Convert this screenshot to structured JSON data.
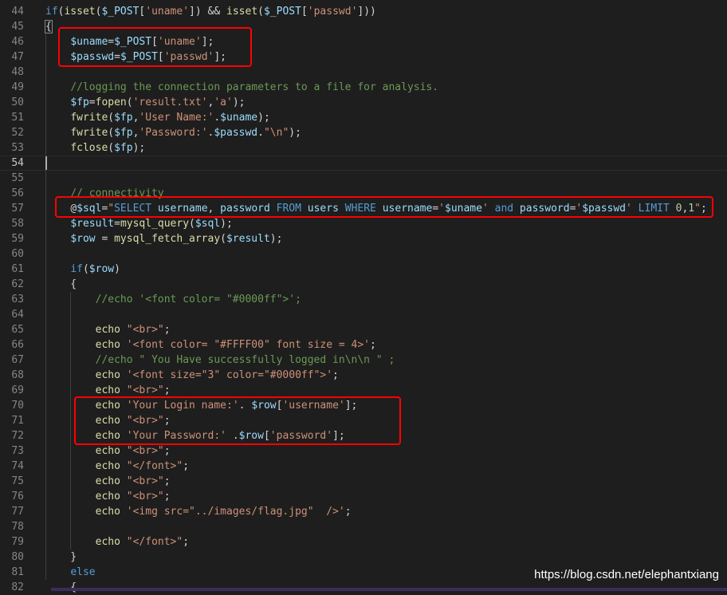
{
  "editor": {
    "colors": {
      "background": "#1e1e1e",
      "keyword": "#569cd6",
      "function": "#dcdcaa",
      "variable": "#9cdcfe",
      "string": "#ce9178",
      "comment": "#6a9955",
      "number": "#b5cea8",
      "annotation": "#ff0000"
    },
    "lines": [
      {
        "num": "44",
        "tokens": [
          {
            "t": "k",
            "v": "if"
          },
          {
            "t": "p",
            "v": "("
          },
          {
            "t": "f",
            "v": "isset"
          },
          {
            "t": "p",
            "v": "("
          },
          {
            "t": "v",
            "v": "$_POST"
          },
          {
            "t": "p",
            "v": "["
          },
          {
            "t": "s",
            "v": "'uname'"
          },
          {
            "t": "p",
            "v": "]) && "
          },
          {
            "t": "f",
            "v": "isset"
          },
          {
            "t": "p",
            "v": "("
          },
          {
            "t": "v",
            "v": "$_POST"
          },
          {
            "t": "p",
            "v": "["
          },
          {
            "t": "s",
            "v": "'passwd'"
          },
          {
            "t": "p",
            "v": "]))"
          }
        ]
      },
      {
        "num": "45",
        "tokens": [
          {
            "t": "p",
            "v": "{"
          }
        ]
      },
      {
        "num": "46",
        "tokens": [
          {
            "t": "p",
            "v": "    "
          },
          {
            "t": "v",
            "v": "$uname"
          },
          {
            "t": "p",
            "v": "="
          },
          {
            "t": "v",
            "v": "$_POST"
          },
          {
            "t": "p",
            "v": "["
          },
          {
            "t": "s",
            "v": "'uname'"
          },
          {
            "t": "p",
            "v": "];"
          }
        ]
      },
      {
        "num": "47",
        "tokens": [
          {
            "t": "p",
            "v": "    "
          },
          {
            "t": "v",
            "v": "$passwd"
          },
          {
            "t": "p",
            "v": "="
          },
          {
            "t": "v",
            "v": "$_POST"
          },
          {
            "t": "p",
            "v": "["
          },
          {
            "t": "s",
            "v": "'passwd'"
          },
          {
            "t": "p",
            "v": "];"
          }
        ]
      },
      {
        "num": "48",
        "tokens": []
      },
      {
        "num": "49",
        "tokens": [
          {
            "t": "p",
            "v": "    "
          },
          {
            "t": "c",
            "v": "//logging the connection parameters to a file for analysis."
          }
        ]
      },
      {
        "num": "50",
        "tokens": [
          {
            "t": "p",
            "v": "    "
          },
          {
            "t": "v",
            "v": "$fp"
          },
          {
            "t": "p",
            "v": "="
          },
          {
            "t": "f",
            "v": "fopen"
          },
          {
            "t": "p",
            "v": "("
          },
          {
            "t": "s",
            "v": "'result.txt'"
          },
          {
            "t": "p",
            "v": ","
          },
          {
            "t": "s",
            "v": "'a'"
          },
          {
            "t": "p",
            "v": ");"
          }
        ]
      },
      {
        "num": "51",
        "tokens": [
          {
            "t": "p",
            "v": "    "
          },
          {
            "t": "f",
            "v": "fwrite"
          },
          {
            "t": "p",
            "v": "("
          },
          {
            "t": "v",
            "v": "$fp"
          },
          {
            "t": "p",
            "v": ","
          },
          {
            "t": "s",
            "v": "'User Name:'"
          },
          {
            "t": "p",
            "v": "."
          },
          {
            "t": "v",
            "v": "$uname"
          },
          {
            "t": "p",
            "v": ");"
          }
        ]
      },
      {
        "num": "52",
        "tokens": [
          {
            "t": "p",
            "v": "    "
          },
          {
            "t": "f",
            "v": "fwrite"
          },
          {
            "t": "p",
            "v": "("
          },
          {
            "t": "v",
            "v": "$fp"
          },
          {
            "t": "p",
            "v": ","
          },
          {
            "t": "s",
            "v": "'Password:'"
          },
          {
            "t": "p",
            "v": "."
          },
          {
            "t": "v",
            "v": "$passwd"
          },
          {
            "t": "p",
            "v": "."
          },
          {
            "t": "s",
            "v": "\"\\n\""
          },
          {
            "t": "p",
            "v": ");"
          }
        ]
      },
      {
        "num": "53",
        "tokens": [
          {
            "t": "p",
            "v": "    "
          },
          {
            "t": "f",
            "v": "fclose"
          },
          {
            "t": "p",
            "v": "("
          },
          {
            "t": "v",
            "v": "$fp"
          },
          {
            "t": "p",
            "v": ");"
          }
        ]
      },
      {
        "num": "54",
        "tokens": [],
        "current": true
      },
      {
        "num": "55",
        "tokens": []
      },
      {
        "num": "56",
        "tokens": [
          {
            "t": "p",
            "v": "    "
          },
          {
            "t": "c",
            "v": "// connectivity"
          }
        ]
      },
      {
        "num": "57",
        "tokens": [
          {
            "t": "p",
            "v": "    "
          },
          {
            "t": "p",
            "v": "@"
          },
          {
            "t": "v",
            "v": "$sql"
          },
          {
            "t": "p",
            "v": "="
          },
          {
            "t": "s",
            "v": "\""
          },
          {
            "t": "k",
            "v": "SELECT"
          },
          {
            "t": "v",
            "v": " username"
          },
          {
            "t": "p",
            "v": ","
          },
          {
            "t": "v",
            "v": " password "
          },
          {
            "t": "k",
            "v": "FROM"
          },
          {
            "t": "v",
            "v": " users "
          },
          {
            "t": "k",
            "v": "WHERE"
          },
          {
            "t": "v",
            "v": " username"
          },
          {
            "t": "p",
            "v": "="
          },
          {
            "t": "s",
            "v": "'"
          },
          {
            "t": "v",
            "v": "$uname"
          },
          {
            "t": "s",
            "v": "'"
          },
          {
            "t": "k",
            "v": " and"
          },
          {
            "t": "v",
            "v": " password"
          },
          {
            "t": "p",
            "v": "="
          },
          {
            "t": "s",
            "v": "'"
          },
          {
            "t": "v",
            "v": "$passwd"
          },
          {
            "t": "s",
            "v": "'"
          },
          {
            "t": "k",
            "v": " LIMIT"
          },
          {
            "t": "n",
            "v": " 0"
          },
          {
            "t": "p",
            "v": ","
          },
          {
            "t": "n",
            "v": "1"
          },
          {
            "t": "s",
            "v": "\""
          },
          {
            "t": "p",
            "v": ";"
          }
        ]
      },
      {
        "num": "58",
        "tokens": [
          {
            "t": "p",
            "v": "    "
          },
          {
            "t": "v",
            "v": "$result"
          },
          {
            "t": "p",
            "v": "="
          },
          {
            "t": "f",
            "v": "mysql_query"
          },
          {
            "t": "p",
            "v": "("
          },
          {
            "t": "v",
            "v": "$sql"
          },
          {
            "t": "p",
            "v": ");"
          }
        ]
      },
      {
        "num": "59",
        "tokens": [
          {
            "t": "p",
            "v": "    "
          },
          {
            "t": "v",
            "v": "$row"
          },
          {
            "t": "p",
            "v": " = "
          },
          {
            "t": "f",
            "v": "mysql_fetch_array"
          },
          {
            "t": "p",
            "v": "("
          },
          {
            "t": "v",
            "v": "$result"
          },
          {
            "t": "p",
            "v": ");"
          }
        ]
      },
      {
        "num": "60",
        "tokens": []
      },
      {
        "num": "61",
        "tokens": [
          {
            "t": "p",
            "v": "    "
          },
          {
            "t": "k",
            "v": "if"
          },
          {
            "t": "p",
            "v": "("
          },
          {
            "t": "v",
            "v": "$row"
          },
          {
            "t": "p",
            "v": ")"
          }
        ]
      },
      {
        "num": "62",
        "tokens": [
          {
            "t": "p",
            "v": "    {"
          }
        ]
      },
      {
        "num": "63",
        "tokens": [
          {
            "t": "p",
            "v": "        "
          },
          {
            "t": "c",
            "v": "//echo '<font color= \"#0000ff\">';"
          }
        ]
      },
      {
        "num": "64",
        "tokens": []
      },
      {
        "num": "65",
        "tokens": [
          {
            "t": "p",
            "v": "        "
          },
          {
            "t": "f",
            "v": "echo"
          },
          {
            "t": "p",
            "v": " "
          },
          {
            "t": "s",
            "v": "\"<br>\""
          },
          {
            "t": "p",
            "v": ";"
          }
        ]
      },
      {
        "num": "66",
        "tokens": [
          {
            "t": "p",
            "v": "        "
          },
          {
            "t": "f",
            "v": "echo"
          },
          {
            "t": "p",
            "v": " "
          },
          {
            "t": "s",
            "v": "'<font color= \"#FFFF00\" font size = 4>'"
          },
          {
            "t": "p",
            "v": ";"
          }
        ]
      },
      {
        "num": "67",
        "tokens": [
          {
            "t": "p",
            "v": "        "
          },
          {
            "t": "c",
            "v": "//echo \" You Have successfully logged in\\n\\n \" ;"
          }
        ]
      },
      {
        "num": "68",
        "tokens": [
          {
            "t": "p",
            "v": "        "
          },
          {
            "t": "f",
            "v": "echo"
          },
          {
            "t": "p",
            "v": " "
          },
          {
            "t": "s",
            "v": "'<font size=\"3\" color=\"#0000ff\">'"
          },
          {
            "t": "p",
            "v": ";"
          }
        ]
      },
      {
        "num": "69",
        "tokens": [
          {
            "t": "p",
            "v": "        "
          },
          {
            "t": "f",
            "v": "echo"
          },
          {
            "t": "p",
            "v": " "
          },
          {
            "t": "s",
            "v": "\"<br>\""
          },
          {
            "t": "p",
            "v": ";"
          }
        ]
      },
      {
        "num": "70",
        "tokens": [
          {
            "t": "p",
            "v": "        "
          },
          {
            "t": "f",
            "v": "echo"
          },
          {
            "t": "p",
            "v": " "
          },
          {
            "t": "s",
            "v": "'Your Login name:'"
          },
          {
            "t": "p",
            "v": ". "
          },
          {
            "t": "v",
            "v": "$row"
          },
          {
            "t": "p",
            "v": "["
          },
          {
            "t": "s",
            "v": "'username'"
          },
          {
            "t": "p",
            "v": "];"
          }
        ]
      },
      {
        "num": "71",
        "tokens": [
          {
            "t": "p",
            "v": "        "
          },
          {
            "t": "f",
            "v": "echo"
          },
          {
            "t": "p",
            "v": " "
          },
          {
            "t": "s",
            "v": "\"<br>\""
          },
          {
            "t": "p",
            "v": ";"
          }
        ]
      },
      {
        "num": "72",
        "tokens": [
          {
            "t": "p",
            "v": "        "
          },
          {
            "t": "f",
            "v": "echo"
          },
          {
            "t": "p",
            "v": " "
          },
          {
            "t": "s",
            "v": "'Your Password:'"
          },
          {
            "t": "p",
            "v": " ."
          },
          {
            "t": "v",
            "v": "$row"
          },
          {
            "t": "p",
            "v": "["
          },
          {
            "t": "s",
            "v": "'password'"
          },
          {
            "t": "p",
            "v": "];"
          }
        ]
      },
      {
        "num": "73",
        "tokens": [
          {
            "t": "p",
            "v": "        "
          },
          {
            "t": "f",
            "v": "echo"
          },
          {
            "t": "p",
            "v": " "
          },
          {
            "t": "s",
            "v": "\"<br>\""
          },
          {
            "t": "p",
            "v": ";"
          }
        ]
      },
      {
        "num": "74",
        "tokens": [
          {
            "t": "p",
            "v": "        "
          },
          {
            "t": "f",
            "v": "echo"
          },
          {
            "t": "p",
            "v": " "
          },
          {
            "t": "s",
            "v": "\"</font>\""
          },
          {
            "t": "p",
            "v": ";"
          }
        ]
      },
      {
        "num": "75",
        "tokens": [
          {
            "t": "p",
            "v": "        "
          },
          {
            "t": "f",
            "v": "echo"
          },
          {
            "t": "p",
            "v": " "
          },
          {
            "t": "s",
            "v": "\"<br>\""
          },
          {
            "t": "p",
            "v": ";"
          }
        ]
      },
      {
        "num": "76",
        "tokens": [
          {
            "t": "p",
            "v": "        "
          },
          {
            "t": "f",
            "v": "echo"
          },
          {
            "t": "p",
            "v": " "
          },
          {
            "t": "s",
            "v": "\"<br>\""
          },
          {
            "t": "p",
            "v": ";"
          }
        ]
      },
      {
        "num": "77",
        "tokens": [
          {
            "t": "p",
            "v": "        "
          },
          {
            "t": "f",
            "v": "echo"
          },
          {
            "t": "p",
            "v": " "
          },
          {
            "t": "s",
            "v": "'<img src=\"../images/flag.jpg\"  />'"
          },
          {
            "t": "p",
            "v": ";"
          }
        ]
      },
      {
        "num": "78",
        "tokens": []
      },
      {
        "num": "79",
        "tokens": [
          {
            "t": "p",
            "v": "        "
          },
          {
            "t": "f",
            "v": "echo"
          },
          {
            "t": "p",
            "v": " "
          },
          {
            "t": "s",
            "v": "\"</font>\""
          },
          {
            "t": "p",
            "v": ";"
          }
        ]
      },
      {
        "num": "80",
        "tokens": [
          {
            "t": "p",
            "v": "    }"
          }
        ]
      },
      {
        "num": "81",
        "tokens": [
          {
            "t": "p",
            "v": "    "
          },
          {
            "t": "k",
            "v": "else"
          }
        ]
      },
      {
        "num": "82",
        "tokens": [
          {
            "t": "p",
            "v": "    {"
          }
        ]
      }
    ]
  },
  "watermark": "https://blog.csdn.net/elephantxiang"
}
